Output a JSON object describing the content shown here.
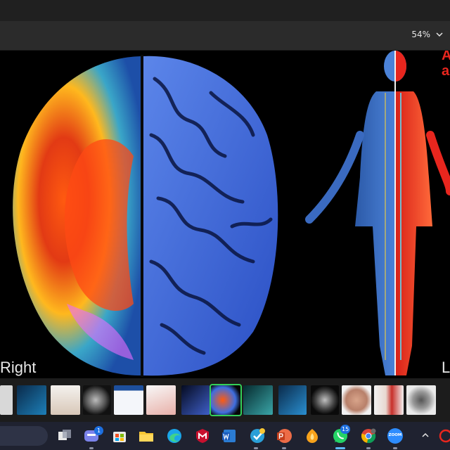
{
  "toolbar": {
    "zoom_level": "54%"
  },
  "viewer": {
    "label_right": "Right",
    "label_left_fragment": "L",
    "corner_text": [
      "A",
      "a"
    ]
  },
  "filmstrip": {
    "selected_index": 7,
    "thumbnail_count": 15
  },
  "taskbar": {
    "teams_badge": "1",
    "whatsapp_badge": "15",
    "zoom_label": "ZOOM"
  },
  "colors": {
    "titlebar": "#202020",
    "toolbar": "#2b2b2b",
    "filmstrip": "#1c1c1c",
    "taskbar": "#1f2230",
    "selection_outline": "#34d058",
    "accent_red": "#e8261e"
  }
}
